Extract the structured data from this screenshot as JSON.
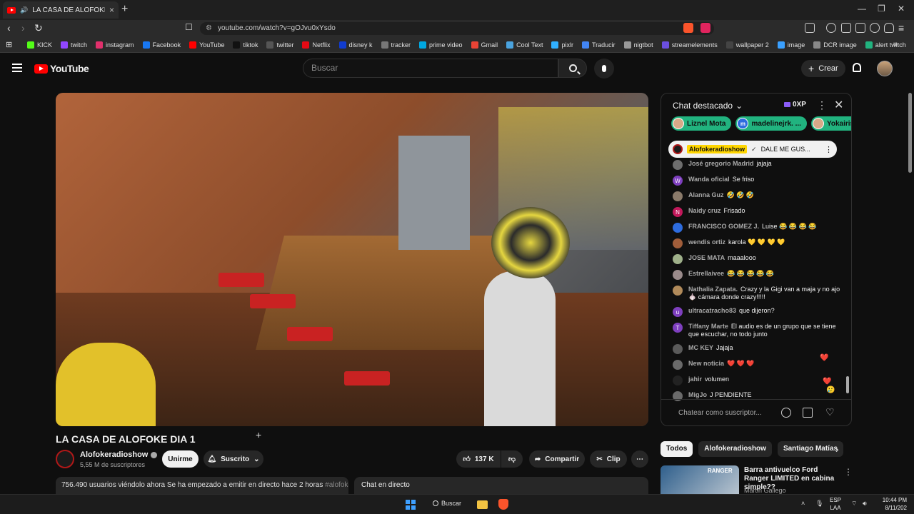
{
  "browser": {
    "tab_title": "LA CASA DE ALOFOKE DIA 1",
    "url": "youtube.com/watch?v=gOJvu0xYsdo",
    "bookmarks": [
      {
        "label": "KICK",
        "color": "#53fc18"
      },
      {
        "label": "twitch",
        "color": "#9146ff"
      },
      {
        "label": "instagram",
        "color": "#e1306c"
      },
      {
        "label": "Facebook",
        "color": "#1877f2"
      },
      {
        "label": "YouTube",
        "color": "#ff0000"
      },
      {
        "label": "tiktok",
        "color": "#111111"
      },
      {
        "label": "twitter",
        "color": "#555555"
      },
      {
        "label": "Netflix",
        "color": "#e50914"
      },
      {
        "label": "disney k",
        "color": "#113ccf"
      },
      {
        "label": "tracker",
        "color": "#777777"
      },
      {
        "label": "prime video",
        "color": "#00a8e1"
      },
      {
        "label": "Gmail",
        "color": "#ea4335"
      },
      {
        "label": "Cool Text",
        "color": "#4aa3df"
      },
      {
        "label": "pixlr",
        "color": "#30b0ff"
      },
      {
        "label": "Traducir",
        "color": "#4285f4"
      },
      {
        "label": "nigtbot",
        "color": "#999999"
      },
      {
        "label": "streamelements",
        "color": "#6b4fe0"
      },
      {
        "label": "wallpaper 2",
        "color": "#444444"
      },
      {
        "label": "image",
        "color": "#3aa0ff"
      },
      {
        "label": "DCR image",
        "color": "#888888"
      },
      {
        "label": "alert twitch",
        "color": "#21b37f"
      }
    ]
  },
  "header": {
    "logo_text": "YouTube",
    "search_placeholder": "Buscar",
    "create_label": "Crear"
  },
  "video": {
    "title": "LA CASA DE ALOFOKE DIA 1",
    "channel": "Alofokeradioshow",
    "subscribers": "5,55 M de suscriptores",
    "join_label": "Unirme",
    "subscribed_label": "Suscrito",
    "likes": "137 K",
    "share_label": "Compartir",
    "clip_label": "Clip",
    "description_stats": "756.490 usuarios viéndolo ahora  Se ha empezado a emitir en directo hace 2 horas",
    "description_tag": "#alofoke",
    "live_chat_label": "Chat en directo"
  },
  "chat": {
    "header_label": "Chat destacado",
    "xp_label": "0XP",
    "chips": [
      {
        "name": "Liznel Mota",
        "initial": ""
      },
      {
        "name": "madelinejrk. ...",
        "initial": "m"
      },
      {
        "name": "Yokairis",
        "initial": ""
      }
    ],
    "pinned": {
      "author": "Alofokeradioshow",
      "text": "DALE ME GUS..."
    },
    "messages": [
      {
        "author": "José gregorio Madrid",
        "text": "jajaja",
        "initial": "",
        "color": "#6d6d6d"
      },
      {
        "author": "Wanda oficial",
        "text": "Se friso",
        "initial": "W",
        "color": "#7e3fbf"
      },
      {
        "author": "Alanna Guz",
        "text": "🤣 🤣 🤣",
        "initial": "",
        "color": "#8a7a6a"
      },
      {
        "author": "Naidy cruz",
        "text": "Frisado",
        "initial": "N",
        "color": "#c2185b"
      },
      {
        "author": "FRANCISCO GOMEZ J.",
        "text": "Luise 😂 😂 😂 😂",
        "initial": "",
        "color": "#2d6cdf"
      },
      {
        "author": "wendis ortiz",
        "text": "karola 💛 💛 💛 💛",
        "initial": "",
        "color": "#a05d3a"
      },
      {
        "author": "JOSE MATA",
        "text": "maaalooo",
        "initial": "",
        "color": "#9fb08a"
      },
      {
        "author": "Estrellaivee",
        "text": "😂 😂 😂 😂 😂",
        "initial": "",
        "color": "#9a8b8b"
      },
      {
        "author": "Nathalia Zapata.",
        "text": "Crazy y la Gigi van a maja y no ajo 🧄 cámara donde crazy!!!!!",
        "initial": "",
        "color": "#b08a5a"
      },
      {
        "author": "ultracatracho83",
        "text": "que dijeron?",
        "initial": "u",
        "color": "#7e3fbf"
      },
      {
        "author": "Tiffany Marte",
        "text": "El audio es de un grupo que se tiene que escuchar, no todo junto",
        "initial": "T",
        "color": "#7e3fbf"
      },
      {
        "author": "MC KEY",
        "text": "Jajaja",
        "initial": "",
        "color": "#5a5a5a"
      },
      {
        "author": "New noticia",
        "text": "❤️ ❤️ ❤️",
        "initial": "",
        "color": "#6a6a6a"
      },
      {
        "author": "jahir",
        "text": "volumen",
        "initial": "",
        "color": "#222222"
      },
      {
        "author": "MigJo",
        "text": "J PENDIENTE",
        "initial": "",
        "color": "#6a6a6a"
      }
    ],
    "input_placeholder": "Chatear como suscriptor..."
  },
  "related": {
    "chips": [
      "Todos",
      "Alofokeradioshow",
      "Santiago Matías"
    ],
    "first_title": "Barra antivuelco Ford Ranger LIMITED en cabina simple??",
    "first_channel": "Martin Gallego",
    "first_thumb_label": "RANGER"
  },
  "taskbar": {
    "search_label": "Buscar",
    "lang_line1": "ESP",
    "lang_line2": "LAA",
    "time": "10:44 PM",
    "date": "8/11/202"
  }
}
